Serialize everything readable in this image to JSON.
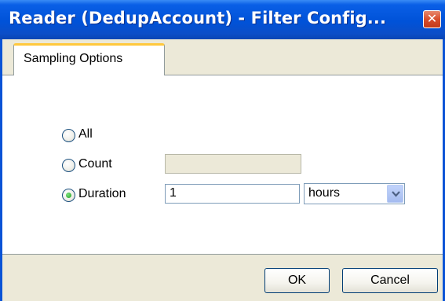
{
  "window": {
    "title": "Reader (DedupAccount) - Filter Config...",
    "close_glyph": "✕"
  },
  "tabs": [
    {
      "label": "Sampling Options",
      "selected": true
    }
  ],
  "options": {
    "all": {
      "label": "All",
      "selected": false
    },
    "count": {
      "label": "Count",
      "selected": false,
      "value": "",
      "enabled": false
    },
    "duration": {
      "label": "Duration",
      "selected": true,
      "value": "1",
      "unit": "hours"
    }
  },
  "buttons": {
    "ok": "OK",
    "cancel": "Cancel"
  },
  "colors": {
    "titlebar": "#0052d8",
    "tab_highlight": "#ffc83c",
    "radio_dot": "#21a121"
  }
}
